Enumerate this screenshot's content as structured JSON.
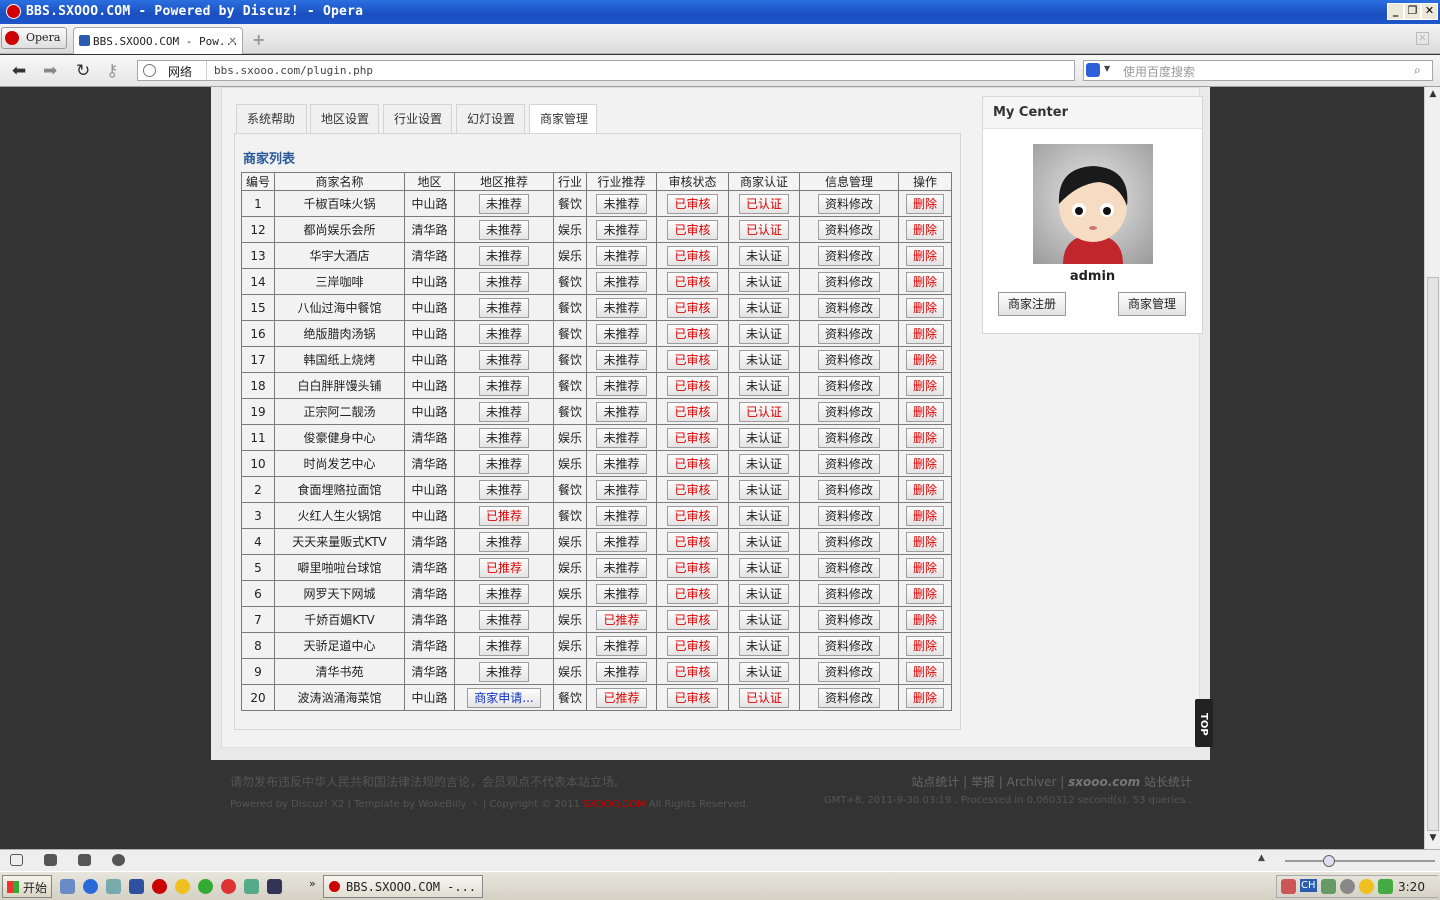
{
  "window": {
    "title": "BBS.SXOOO.COM - Powered by Discuz! - Opera"
  },
  "browser": {
    "menu_label": "Opera",
    "tab_title": "BBS.SXOOO.COM - Pow...",
    "address_zone": "网络",
    "url": "bbs.sxooo.com/plugin.php",
    "search_placeholder": "使用百度搜索"
  },
  "tabs": [
    "系统帮助",
    "地区设置",
    "行业设置",
    "幻灯设置",
    "商家管理"
  ],
  "active_tab": "商家管理",
  "list_title": "商家列表",
  "table": {
    "headers": [
      "编号",
      "商家名称",
      "地区",
      "地区推荐",
      "行业",
      "行业推荐",
      "审核状态",
      "商家认证",
      "信息管理",
      "操作"
    ],
    "edit_label": "资料修改",
    "delete_label": "删除",
    "rows": [
      {
        "id": "1",
        "name": "千椒百味火锅",
        "area": "中山路",
        "area_rec": "未推荐",
        "industry": "餐饮",
        "ind_rec": "未推荐",
        "audit": "已审核",
        "cert": "已认证"
      },
      {
        "id": "12",
        "name": "都尚娱乐会所",
        "area": "清华路",
        "area_rec": "未推荐",
        "industry": "娱乐",
        "ind_rec": "未推荐",
        "audit": "已审核",
        "cert": "已认证"
      },
      {
        "id": "13",
        "name": "华宇大酒店",
        "area": "清华路",
        "area_rec": "未推荐",
        "industry": "娱乐",
        "ind_rec": "未推荐",
        "audit": "已审核",
        "cert": "未认证"
      },
      {
        "id": "14",
        "name": "三岸咖啡",
        "area": "中山路",
        "area_rec": "未推荐",
        "industry": "餐饮",
        "ind_rec": "未推荐",
        "audit": "已审核",
        "cert": "未认证"
      },
      {
        "id": "15",
        "name": "八仙过海中餐馆",
        "area": "中山路",
        "area_rec": "未推荐",
        "industry": "餐饮",
        "ind_rec": "未推荐",
        "audit": "已审核",
        "cert": "未认证"
      },
      {
        "id": "16",
        "name": "绝版腊肉汤锅",
        "area": "中山路",
        "area_rec": "未推荐",
        "industry": "餐饮",
        "ind_rec": "未推荐",
        "audit": "已审核",
        "cert": "未认证"
      },
      {
        "id": "17",
        "name": "韩国纸上烧烤",
        "area": "中山路",
        "area_rec": "未推荐",
        "industry": "餐饮",
        "ind_rec": "未推荐",
        "audit": "已审核",
        "cert": "未认证"
      },
      {
        "id": "18",
        "name": "白白胖胖馒头铺",
        "area": "中山路",
        "area_rec": "未推荐",
        "industry": "餐饮",
        "ind_rec": "未推荐",
        "audit": "已审核",
        "cert": "未认证"
      },
      {
        "id": "19",
        "name": "正宗阿二靓汤",
        "area": "中山路",
        "area_rec": "未推荐",
        "industry": "餐饮",
        "ind_rec": "未推荐",
        "audit": "已审核",
        "cert": "已认证"
      },
      {
        "id": "11",
        "name": "俊豪健身中心",
        "area": "清华路",
        "area_rec": "未推荐",
        "industry": "娱乐",
        "ind_rec": "未推荐",
        "audit": "已审核",
        "cert": "未认证"
      },
      {
        "id": "10",
        "name": "时尚发艺中心",
        "area": "清华路",
        "area_rec": "未推荐",
        "industry": "娱乐",
        "ind_rec": "未推荐",
        "audit": "已审核",
        "cert": "未认证"
      },
      {
        "id": "2",
        "name": "食面埋赂拉面馆",
        "area": "中山路",
        "area_rec": "未推荐",
        "industry": "餐饮",
        "ind_rec": "未推荐",
        "audit": "已审核",
        "cert": "未认证"
      },
      {
        "id": "3",
        "name": "火红人生火锅馆",
        "area": "中山路",
        "area_rec": "已推荐",
        "industry": "餐饮",
        "ind_rec": "未推荐",
        "audit": "已审核",
        "cert": "未认证"
      },
      {
        "id": "4",
        "name": "天天来量贩式KTV",
        "area": "清华路",
        "area_rec": "未推荐",
        "industry": "娱乐",
        "ind_rec": "未推荐",
        "audit": "已审核",
        "cert": "未认证"
      },
      {
        "id": "5",
        "name": "噼里啪啦台球馆",
        "area": "清华路",
        "area_rec": "已推荐",
        "industry": "娱乐",
        "ind_rec": "未推荐",
        "audit": "已审核",
        "cert": "未认证"
      },
      {
        "id": "6",
        "name": "网罗天下网城",
        "area": "清华路",
        "area_rec": "未推荐",
        "industry": "娱乐",
        "ind_rec": "未推荐",
        "audit": "已审核",
        "cert": "未认证"
      },
      {
        "id": "7",
        "name": "千娇百媚KTV",
        "area": "清华路",
        "area_rec": "未推荐",
        "industry": "娱乐",
        "ind_rec": "已推荐",
        "audit": "已审核",
        "cert": "未认证"
      },
      {
        "id": "8",
        "name": "天骄足道中心",
        "area": "清华路",
        "area_rec": "未推荐",
        "industry": "娱乐",
        "ind_rec": "未推荐",
        "audit": "已审核",
        "cert": "未认证"
      },
      {
        "id": "9",
        "name": "清华书苑",
        "area": "清华路",
        "area_rec": "未推荐",
        "industry": "娱乐",
        "ind_rec": "未推荐",
        "audit": "已审核",
        "cert": "未认证"
      },
      {
        "id": "20",
        "name": "波涛汹涌海菜馆",
        "area": "中山路",
        "area_rec": "商家申请...",
        "industry": "餐饮",
        "ind_rec": "已推荐",
        "audit": "已审核",
        "cert": "已认证"
      }
    ]
  },
  "side": {
    "title": "My Center",
    "username": "admin",
    "register_label": "商家注册",
    "manage_label": "商家管理"
  },
  "top_button": "TOP",
  "footer": {
    "notice": "请勿发布违反中华人民共和国法律法规的言论，会员观点不代表本站立场。",
    "powered_prefix": "Powered by Discuz! X2 | Template by WokeBilly ヽ | Copyright © 2011 ",
    "powered_brand": "SXOOO.COM",
    "powered_suffix": " All Rights Reserved.",
    "links": "站点统计 | 举报 | Archiver | ",
    "site_brand": "sxooo.com",
    "site_suffix": " 站长统计",
    "stats": "GMT+8, 2011-9-30 03:19 , Processed in 0.060312 second(s), 53 queries ."
  },
  "taskbar": {
    "start_label": "开始",
    "task_title": "BBS.SXOOO.COM -...",
    "tray_lang": "CH",
    "clock": "3:20"
  },
  "colors": {
    "accent_red": "#e00000",
    "link_blue": "#1030c0",
    "titlebar_blue": "#1a4fbf"
  }
}
